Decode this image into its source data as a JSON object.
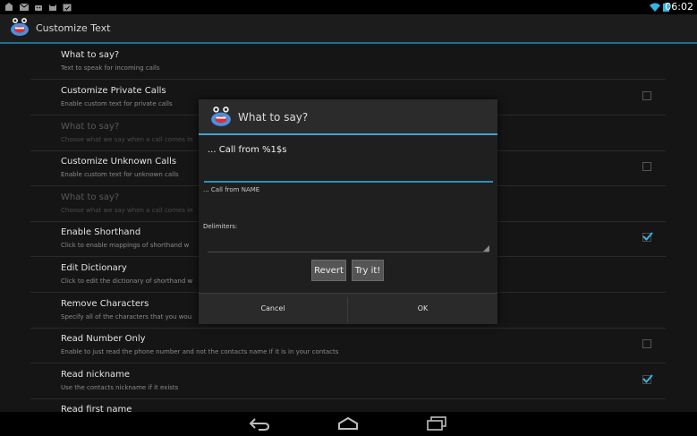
{
  "status": {
    "time": "06:02"
  },
  "actionbar": {
    "title": "Customize Text"
  },
  "settings": [
    {
      "title": "What to say?",
      "summary": "Text to speak for incoming calls",
      "dim": false,
      "checkbox": "none"
    },
    {
      "title": "Customize Private Calls",
      "summary": "Enable custom text for private calls",
      "dim": false,
      "checkbox": "off"
    },
    {
      "title": "What to say?",
      "summary": "Choose what we say when a call comes in",
      "dim": true,
      "checkbox": "none"
    },
    {
      "title": "Customize Unknown Calls",
      "summary": "Enable custom text for unknown calls",
      "dim": false,
      "checkbox": "off"
    },
    {
      "title": "What to say?",
      "summary": "Choose what we say when a call comes in",
      "dim": true,
      "checkbox": "none"
    },
    {
      "title": "Enable Shorthand",
      "summary": "Click to enable mappings of shorthand w",
      "dim": false,
      "checkbox": "on"
    },
    {
      "title": "Edit Dictionary",
      "summary": "Click to edit the dictionary of shorthand w",
      "dim": false,
      "checkbox": "none"
    },
    {
      "title": "Remove Characters",
      "summary": "Specify all of the characters that you wou",
      "dim": false,
      "checkbox": "none"
    },
    {
      "title": "Read Number Only",
      "summary": "Enable to just read the phone number and not the contacts name if it is in your contacts",
      "dim": false,
      "checkbox": "off"
    },
    {
      "title": "Read nickname",
      "summary": "Use the contacts nickname if it exists",
      "dim": false,
      "checkbox": "on"
    },
    {
      "title": "Read first name",
      "summary": "",
      "dim": false,
      "checkbox": "none"
    }
  ],
  "dialog": {
    "title": "What to say?",
    "input_value": "... Call from %1$s",
    "preview": "... Call from NAME",
    "delimiters_label": "Delimiters:",
    "revert_label": "Revert",
    "try_label": "Try it!",
    "cancel_label": "Cancel",
    "ok_label": "OK"
  },
  "icons": {
    "status": [
      "photo-icon",
      "gmail-icon",
      "android-icon",
      "cat-icon",
      "calendar-icon",
      "wifi-icon",
      "battery-icon"
    ],
    "nav": [
      "back-icon",
      "home-icon",
      "recents-icon"
    ]
  },
  "colors": {
    "accent": "#33b5e5",
    "app_icon": "#4b8fe0",
    "mouth": "#d33030"
  }
}
